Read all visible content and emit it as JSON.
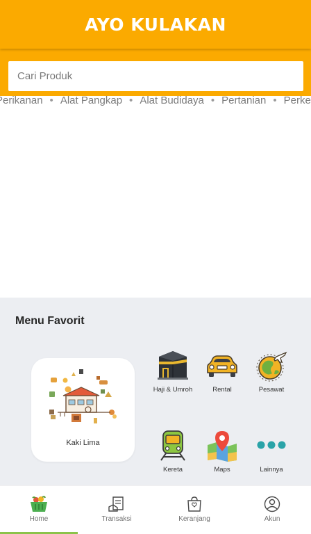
{
  "header": {
    "title": "AYO KULAKAN"
  },
  "search": {
    "placeholder": "Cari Produk"
  },
  "categories": [
    "Perikanan",
    "Alat Pangkap",
    "Alat Budidaya",
    "Pertanian",
    "Perkebunan"
  ],
  "favorites": {
    "heading": "Menu Favorit",
    "featured": {
      "label": "Kaki Lima",
      "icon": "street-vendor-illustration"
    },
    "items": [
      {
        "label": "Haji & Umroh",
        "icon": "kaaba-icon"
      },
      {
        "label": "Rental",
        "icon": "car-icon"
      },
      {
        "label": "Pesawat",
        "icon": "airplane-globe-icon"
      },
      {
        "label": "Kereta",
        "icon": "train-icon"
      },
      {
        "label": "Maps",
        "icon": "map-pin-icon"
      },
      {
        "label": "Lainnya",
        "icon": "more-dots-icon"
      }
    ]
  },
  "bottom_nav": {
    "items": [
      {
        "label": "Home",
        "icon": "basket-icon",
        "active": true
      },
      {
        "label": "Transaksi",
        "icon": "receipt-icon",
        "active": false
      },
      {
        "label": "Keranjang",
        "icon": "shopping-bag-icon",
        "active": false
      },
      {
        "label": "Akun",
        "icon": "user-icon",
        "active": false
      }
    ]
  },
  "colors": {
    "primary": "#fbaa00",
    "section_bg": "#eceef2",
    "active_indicator": "#8bc34a"
  }
}
